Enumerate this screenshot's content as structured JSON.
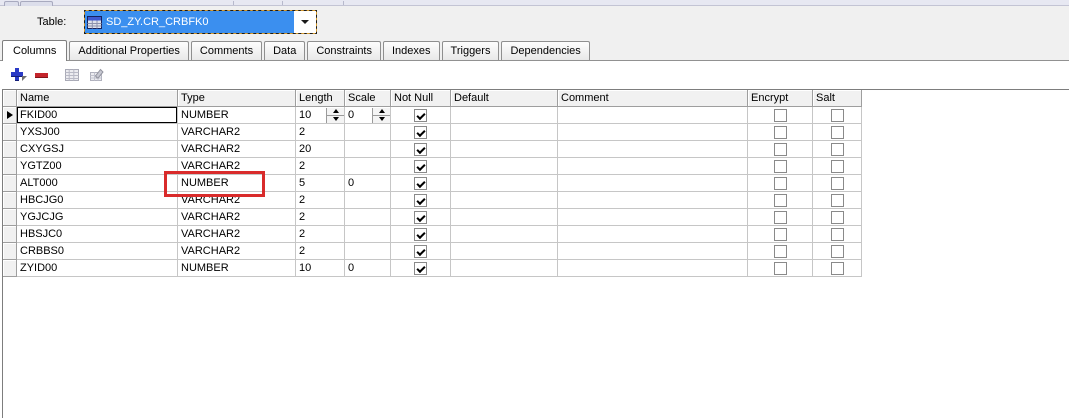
{
  "table_selector": {
    "label": "Table:",
    "value": "SD_ZY.CR_CRBFK0",
    "selection_color": "#3b8fef"
  },
  "tabs": [
    {
      "label": "Columns",
      "active": true
    },
    {
      "label": "Additional Properties",
      "active": false
    },
    {
      "label": "Comments",
      "active": false
    },
    {
      "label": "Data",
      "active": false
    },
    {
      "label": "Constraints",
      "active": false
    },
    {
      "label": "Indexes",
      "active": false
    },
    {
      "label": "Triggers",
      "active": false
    },
    {
      "label": "Dependencies",
      "active": false
    }
  ],
  "toolbar": {
    "buttons": [
      {
        "name": "add-column-button",
        "icon": "plus-icon",
        "enabled": true
      },
      {
        "name": "remove-column-button",
        "icon": "minus-icon",
        "enabled": true
      },
      {
        "name": "grid-view-button",
        "icon": "table-grid-icon",
        "enabled": false
      },
      {
        "name": "table-edit-button",
        "icon": "table-edit-pencil-icon",
        "enabled": false
      }
    ]
  },
  "grid": {
    "columns": [
      "Name",
      "Type",
      "Length",
      "Scale",
      "Not Null",
      "Default",
      "Comment",
      "Encrypt",
      "Salt"
    ],
    "highlight_color": "#d92b2b",
    "rows": [
      {
        "name": "FKID00",
        "type": "NUMBER",
        "length": "10",
        "scale": "0",
        "not_null": true,
        "default": "",
        "comment": "",
        "encrypt": false,
        "salt": false,
        "selected": true,
        "editing": true,
        "highlight": ""
      },
      {
        "name": "YXSJ00",
        "type": "VARCHAR2",
        "length": "2",
        "scale": "",
        "not_null": true,
        "default": "",
        "comment": "",
        "encrypt": false,
        "salt": false,
        "selected": false,
        "editing": false,
        "highlight": ""
      },
      {
        "name": "CXYGSJ",
        "type": "VARCHAR2",
        "length": "20",
        "scale": "",
        "not_null": true,
        "default": "",
        "comment": "",
        "encrypt": false,
        "salt": false,
        "selected": false,
        "editing": false,
        "highlight": ""
      },
      {
        "name": "YGTZ00",
        "type": "VARCHAR2",
        "length": "2",
        "scale": "",
        "not_null": true,
        "default": "",
        "comment": "",
        "encrypt": false,
        "salt": false,
        "selected": false,
        "editing": false,
        "highlight": ""
      },
      {
        "name": "ALT000",
        "type": "NUMBER",
        "length": "5",
        "scale": "0",
        "not_null": true,
        "default": "",
        "comment": "",
        "encrypt": false,
        "salt": false,
        "selected": false,
        "editing": false,
        "highlight": "type"
      },
      {
        "name": "HBCJG0",
        "type": "VARCHAR2",
        "length": "2",
        "scale": "",
        "not_null": true,
        "default": "",
        "comment": "",
        "encrypt": false,
        "salt": false,
        "selected": false,
        "editing": false,
        "highlight": ""
      },
      {
        "name": "YGJCJG",
        "type": "VARCHAR2",
        "length": "2",
        "scale": "",
        "not_null": true,
        "default": "",
        "comment": "",
        "encrypt": false,
        "salt": false,
        "selected": false,
        "editing": false,
        "highlight": ""
      },
      {
        "name": "HBSJC0",
        "type": "VARCHAR2",
        "length": "2",
        "scale": "",
        "not_null": true,
        "default": "",
        "comment": "",
        "encrypt": false,
        "salt": false,
        "selected": false,
        "editing": false,
        "highlight": ""
      },
      {
        "name": "CRBBS0",
        "type": "VARCHAR2",
        "length": "2",
        "scale": "",
        "not_null": true,
        "default": "",
        "comment": "",
        "encrypt": false,
        "salt": false,
        "selected": false,
        "editing": false,
        "highlight": ""
      },
      {
        "name": "ZYID00",
        "type": "NUMBER",
        "length": "10",
        "scale": "0",
        "not_null": true,
        "default": "",
        "comment": "",
        "encrypt": false,
        "salt": false,
        "selected": false,
        "editing": false,
        "highlight": ""
      }
    ]
  }
}
